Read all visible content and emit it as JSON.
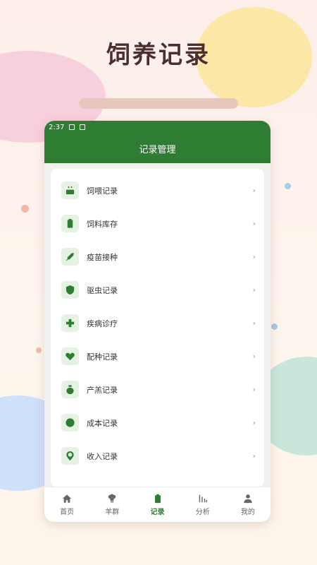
{
  "promo": {
    "title": "饲养记录"
  },
  "status": {
    "time": "2:37"
  },
  "header": {
    "title": "记录管理"
  },
  "menu": {
    "items": [
      {
        "label": "饲喂记录",
        "icon": "feeding-bowl-icon"
      },
      {
        "label": "饲料库存",
        "icon": "battery-icon"
      },
      {
        "label": "疫苗接种",
        "icon": "syringe-icon"
      },
      {
        "label": "驱虫记录",
        "icon": "shield-icon"
      },
      {
        "label": "疾病诊疗",
        "icon": "medical-cross-icon"
      },
      {
        "label": "配种记录",
        "icon": "heart-icon"
      },
      {
        "label": "产羔记录",
        "icon": "bag-icon"
      },
      {
        "label": "成本记录",
        "icon": "circle-icon"
      },
      {
        "label": "收入记录",
        "icon": "money-pin-icon"
      }
    ],
    "chevron": "›"
  },
  "nav": {
    "items": [
      {
        "label": "首页",
        "icon": "home-icon",
        "active": false
      },
      {
        "label": "羊群",
        "icon": "sheep-icon",
        "active": false
      },
      {
        "label": "记录",
        "icon": "clipboard-icon",
        "active": true
      },
      {
        "label": "分析",
        "icon": "bar-chart-icon",
        "active": false
      },
      {
        "label": "我的",
        "icon": "person-icon",
        "active": false
      }
    ]
  },
  "colors": {
    "primary": "#2e7d32",
    "icon_bg": "#e6f2e4",
    "title": "#4a2e32"
  }
}
